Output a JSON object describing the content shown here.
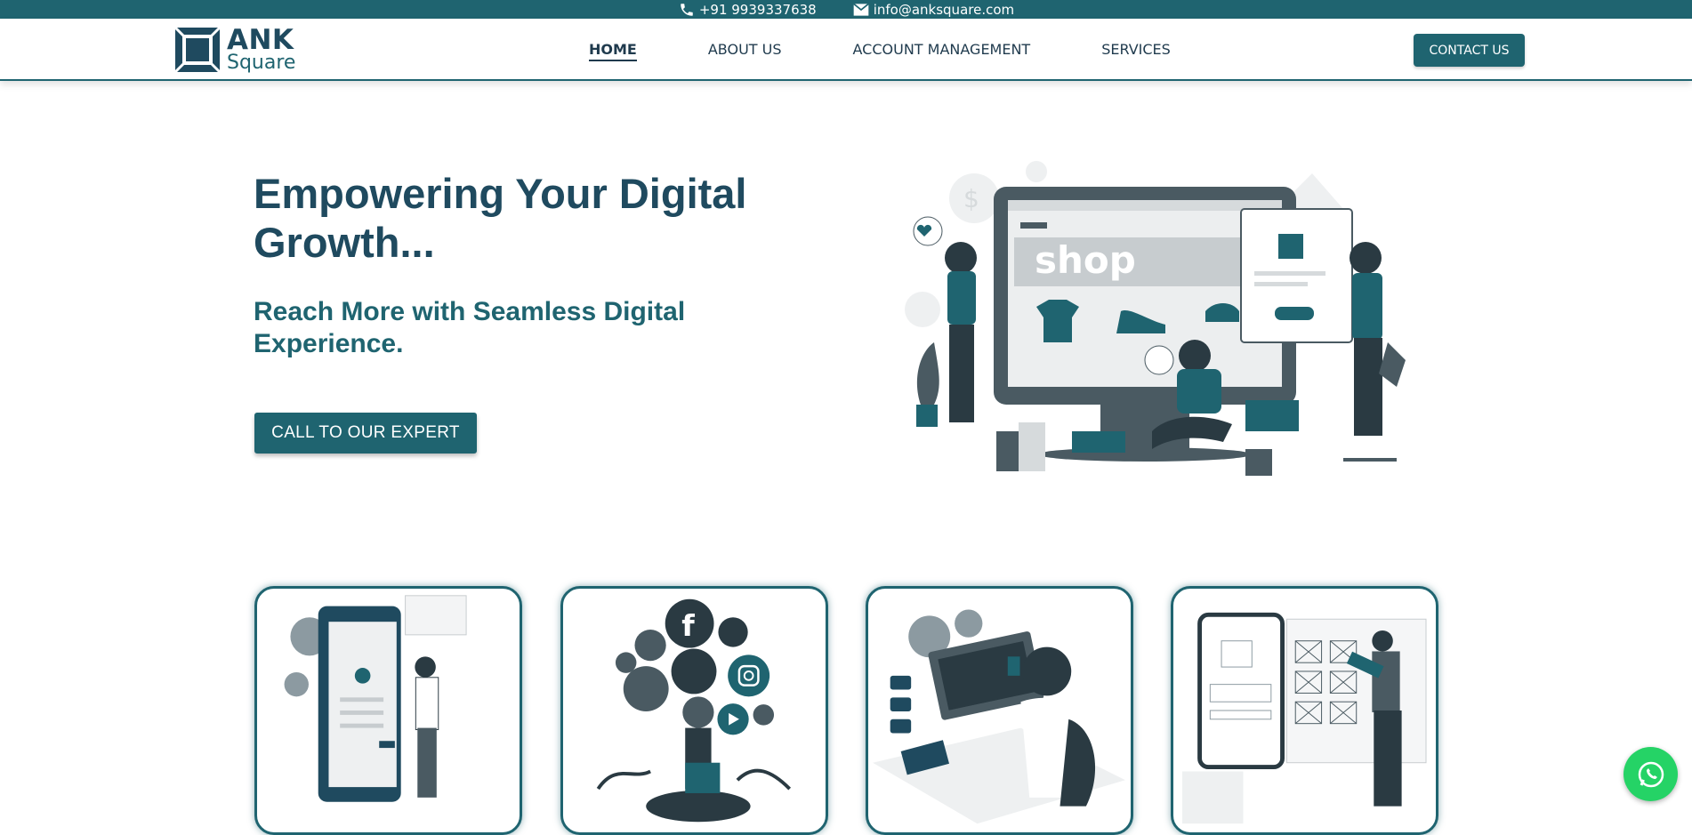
{
  "topbar": {
    "phone": "+91 9939337638",
    "email": "info@anksquare.com",
    "phone_icon": "phone-icon",
    "email_icon": "envelope-icon"
  },
  "brand": {
    "line1": "ANK",
    "line2": "Square"
  },
  "nav": {
    "items": [
      {
        "label": "HOME",
        "active": true
      },
      {
        "label": "ABOUT US",
        "active": false
      },
      {
        "label": "ACCOUNT MANAGEMENT",
        "active": false
      },
      {
        "label": "SERVICES",
        "active": false
      }
    ],
    "contact_label": "CONTACT US"
  },
  "hero": {
    "title": "Empowering Your Digital Growth...",
    "subtitle": "Reach More with Seamless Digital Experience.",
    "cta_label": "CALL TO OUR EXPERT",
    "illustration_text": "shop"
  },
  "cards": [
    {
      "icon": "mobile-app-illustration"
    },
    {
      "icon": "social-media-illustration"
    },
    {
      "icon": "web-development-illustration"
    },
    {
      "icon": "wireframe-design-illustration"
    }
  ],
  "colors": {
    "primary": "#1f6470",
    "dark": "#1f4a5f",
    "whatsapp": "#25d366"
  }
}
